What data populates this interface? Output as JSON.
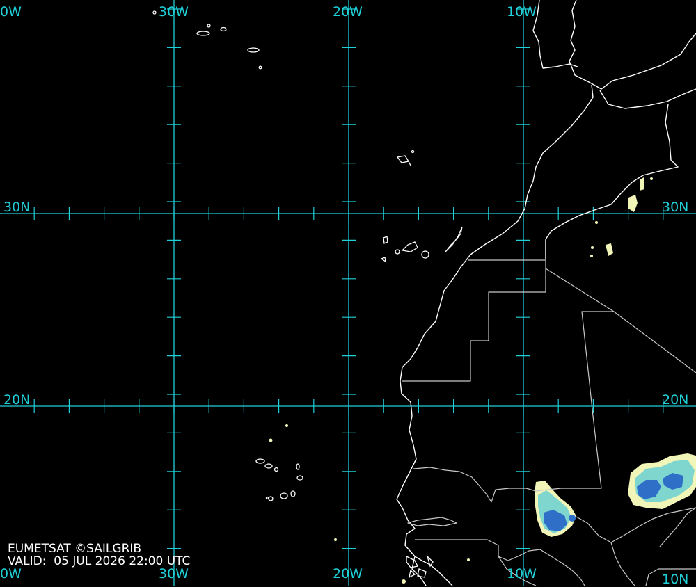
{
  "colors": {
    "background": "#000000",
    "graticule": "#1fd0d8",
    "coastline": "#ffffff",
    "border": "#c8c8c8",
    "precip_light": "#f2f5b8",
    "precip_mid": "#7fd6cf",
    "precip_heavy": "#2f6fc8"
  },
  "graticule": {
    "top_labels": [
      "0W",
      "30W",
      "20W",
      "10W"
    ],
    "bottom_labels": [
      "0W",
      "30W",
      "20W",
      "10W",
      "10N"
    ],
    "left_labels": [
      "30N",
      "20N"
    ],
    "right_labels": [
      "30N",
      "20N"
    ]
  },
  "footer": {
    "credit": "EUMETSAT ©SAILGRIB",
    "valid_label": "VALID:",
    "valid_time": "05 JUL 2026 22:00 UTC"
  }
}
